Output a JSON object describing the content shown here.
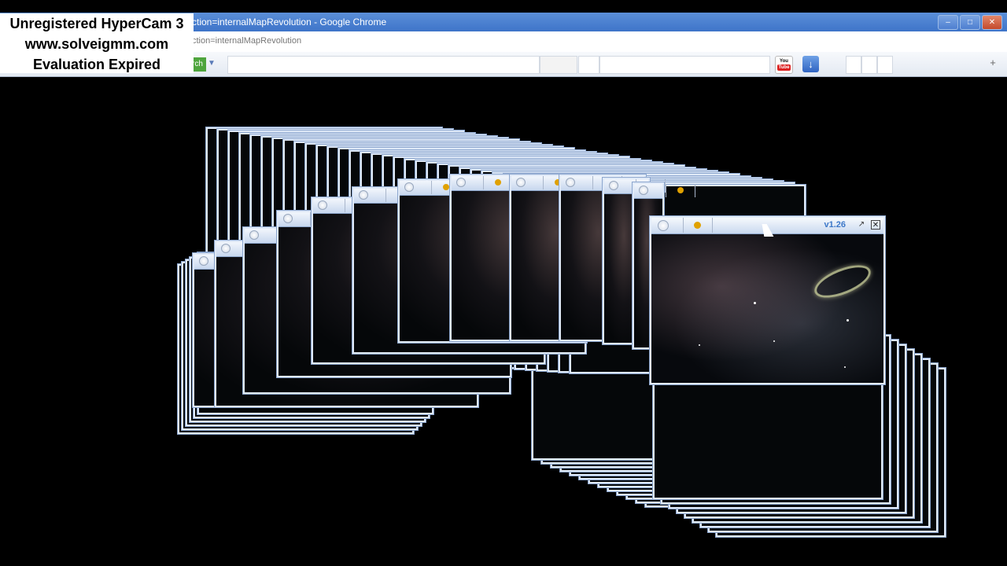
{
  "browser": {
    "title": "ction=internalMapRevolution - Google Chrome",
    "url": "ction=internalMapRevolution",
    "search_button_label": "rch",
    "youtube_icon_top": "You",
    "youtube_icon_bottom": "Tube"
  },
  "watermark": {
    "line1": "Unregistered HyperCam 3",
    "line2": "www.solveigmm.com",
    "line3": "Evaluation Expired"
  },
  "front_window": {
    "version": "v1.26"
  },
  "colors": {
    "titlebar": "#3e74c9",
    "window_border": "#dfe9f7",
    "version_text": "#3e79c9",
    "background": "#000000"
  },
  "icons": [
    "minimize-icon",
    "maximize-icon",
    "close-icon",
    "youtube-icon",
    "download-arrow-icon",
    "new-tab-plus-icon",
    "gear-icon",
    "maximize-small-icon",
    "close-small-icon",
    "mouse-cursor-icon"
  ]
}
